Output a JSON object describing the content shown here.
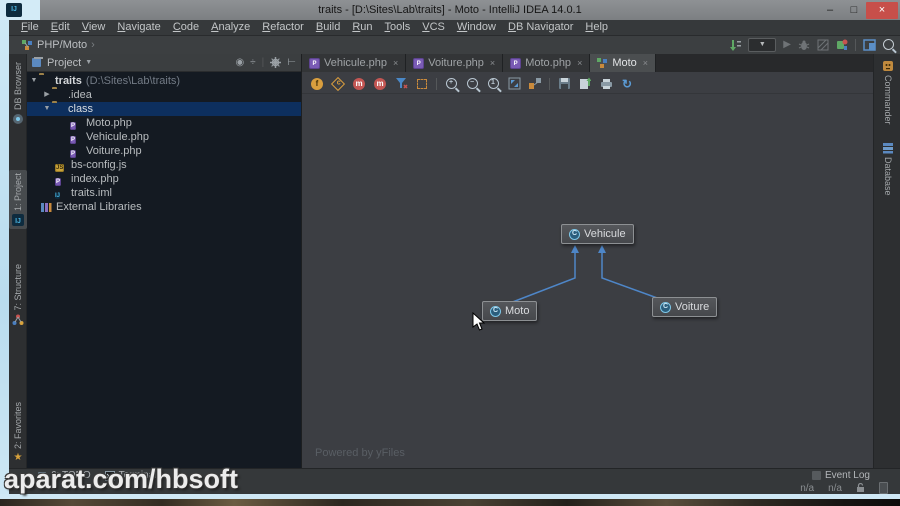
{
  "window": {
    "title": "traits - [D:\\Sites\\Lab\\traits] - Moto - IntelliJ IDEA 14.0.1",
    "minimize": "–",
    "maximize": "□",
    "close": "×"
  },
  "menu": {
    "items": [
      "File",
      "Edit",
      "View",
      "Navigate",
      "Code",
      "Analyze",
      "Refactor",
      "Build",
      "Run",
      "Tools",
      "VCS",
      "Window",
      "DB Navigator",
      "Help"
    ]
  },
  "navbar": {
    "path": "PHP/Moto",
    "chevron": "›"
  },
  "left_stripe": {
    "items": [
      "DB Browser",
      "1: Project",
      "7: Structure",
      "2: Favorites"
    ]
  },
  "right_stripe": {
    "items": [
      "Commander",
      "Database"
    ]
  },
  "project": {
    "header_title": "Project",
    "tree": {
      "root_name": "traits",
      "root_path": "(D:\\Sites\\Lab\\traits)",
      "idea": ".idea",
      "class_folder": "class",
      "files": [
        "Moto.php",
        "Vehicule.php",
        "Voiture.php"
      ],
      "bs_config": "bs-config.js",
      "index": "index.php",
      "iml": "traits.iml",
      "external": "External Libraries"
    }
  },
  "tabs": {
    "close_glyph": "×",
    "items": [
      {
        "label": "Vehicule.php",
        "active": false
      },
      {
        "label": "Voiture.php",
        "active": false
      },
      {
        "label": "Moto.php",
        "active": false
      },
      {
        "label": "Moto",
        "active": true
      }
    ]
  },
  "diagram": {
    "type": "uml-class-diagram",
    "nodes": [
      {
        "label": "Vehicule"
      },
      {
        "label": "Moto"
      },
      {
        "label": "Voiture"
      }
    ],
    "edges": [
      {
        "from": "Moto",
        "to": "Vehicule",
        "kind": "extends"
      },
      {
        "from": "Voiture",
        "to": "Vehicule",
        "kind": "extends"
      }
    ],
    "attribution": "Powered by yFiles"
  },
  "bottom": {
    "todo": "6: TODO",
    "terminal": "Terminal",
    "event_log": "Event Log",
    "status_values": [
      "n/a",
      "n/a"
    ]
  },
  "watermark": "aparat.com/hbsoft",
  "colors": {
    "selection_blue": "#0d2f5e",
    "edge_blue": "#4e86c8",
    "close_red": "#c74f4a",
    "canvas_gray": "#3c3e43",
    "tree_bg": "#141a22",
    "php_purple": "#7a5bb5"
  }
}
